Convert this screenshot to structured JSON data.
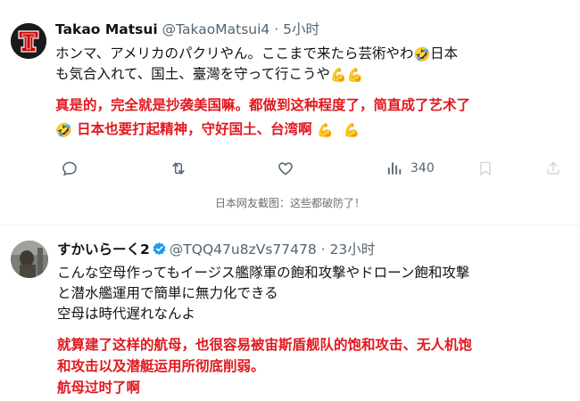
{
  "tweet1": {
    "display_name": "Takao Matsui",
    "handle": "@TakaoMatsui4",
    "separator": "·",
    "time": "5小时",
    "text_line1": "ホンマ、アメリカのパクリやん。ここまで来たら芸術やわ",
    "text_line1_tail": "日本",
    "text_line2": "も気合入れて、国土、臺灣を守って行こうや",
    "translation_line1": "真是的，完全就是抄袭美国嘛。都做到这种程度了，简直成了艺术了",
    "translation_line2": "日本也要打起精神，守好国土、台湾啊",
    "views_count": "340",
    "emoji_laugh": "🤣",
    "emoji_muscle": "💪"
  },
  "caption": "日本网友截图：这些都破防了！",
  "tweet2": {
    "display_name": "すかいらーく2",
    "handle": "@TQQ47u8zVs77478",
    "separator": "·",
    "time": "23小时",
    "text_line1": "こんな空母作ってもイージス艦隊軍の飽和攻撃やドローン飽和攻撃",
    "text_line2": "と潜水艦運用で簡単に無力化できる",
    "text_line3": "空母は時代遅れなんよ",
    "translation_line1": "就算建了这样的航母，也很容易被宙斯盾舰队的饱和攻击、无人机饱",
    "translation_line2": "和攻击以及潜艇运用所彻底削弱。",
    "translation_line3": "航母过时了啊"
  },
  "icons": {
    "reply": "reply-icon",
    "retweet": "retweet-icon",
    "like": "like-icon",
    "views": "views-icon",
    "bookmark": "bookmark-icon",
    "share": "share-icon",
    "verified": "verified-badge-icon"
  },
  "colors": {
    "translation_red": "#e0191f",
    "secondary_text": "#536471",
    "verified_blue": "#1d9bf0"
  }
}
